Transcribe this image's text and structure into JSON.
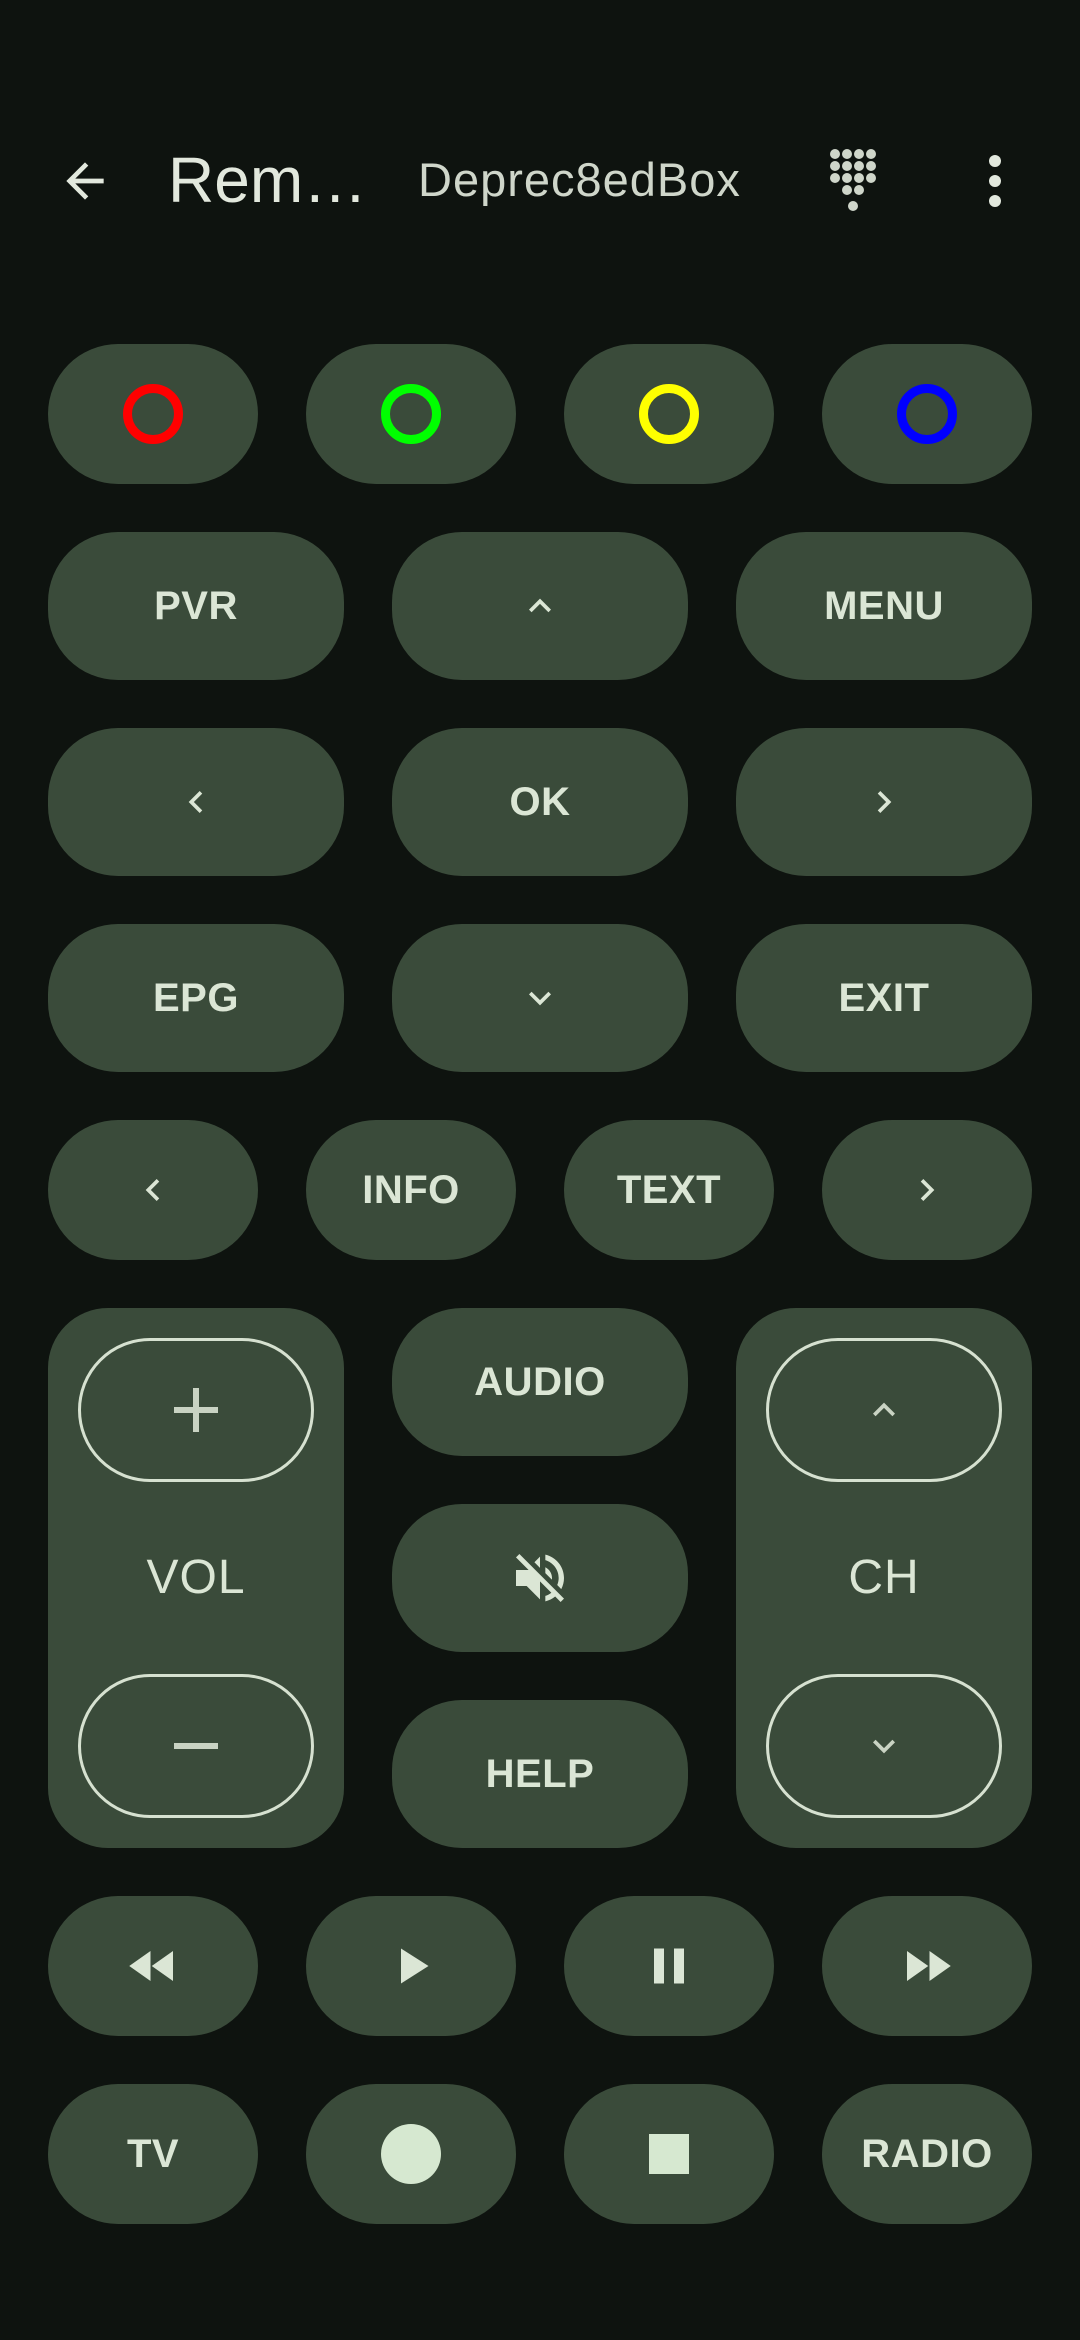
{
  "header": {
    "title": "Rem…",
    "device_name": "Deprec8edBox",
    "back_icon": "arrow-left-icon",
    "keypad_icon": "dialpad-icon",
    "more_icon": "more-vert-icon"
  },
  "colors": {
    "background": "#0e130f",
    "button": "#3a4b3a",
    "button_text": "#dbe6d5",
    "red": "#ff0000",
    "green": "#00ff00",
    "yellow": "#ffff00",
    "blue": "#0000ff"
  },
  "buttons": {
    "pvr": "PVR",
    "menu": "MENU",
    "ok": "OK",
    "epg": "EPG",
    "exit": "EXIT",
    "info": "INFO",
    "text": "TEXT",
    "audio": "AUDIO",
    "help": "HELP",
    "tv": "TV",
    "radio": "RADIO"
  },
  "rockers": {
    "volume_label": "VOL",
    "channel_label": "CH"
  }
}
